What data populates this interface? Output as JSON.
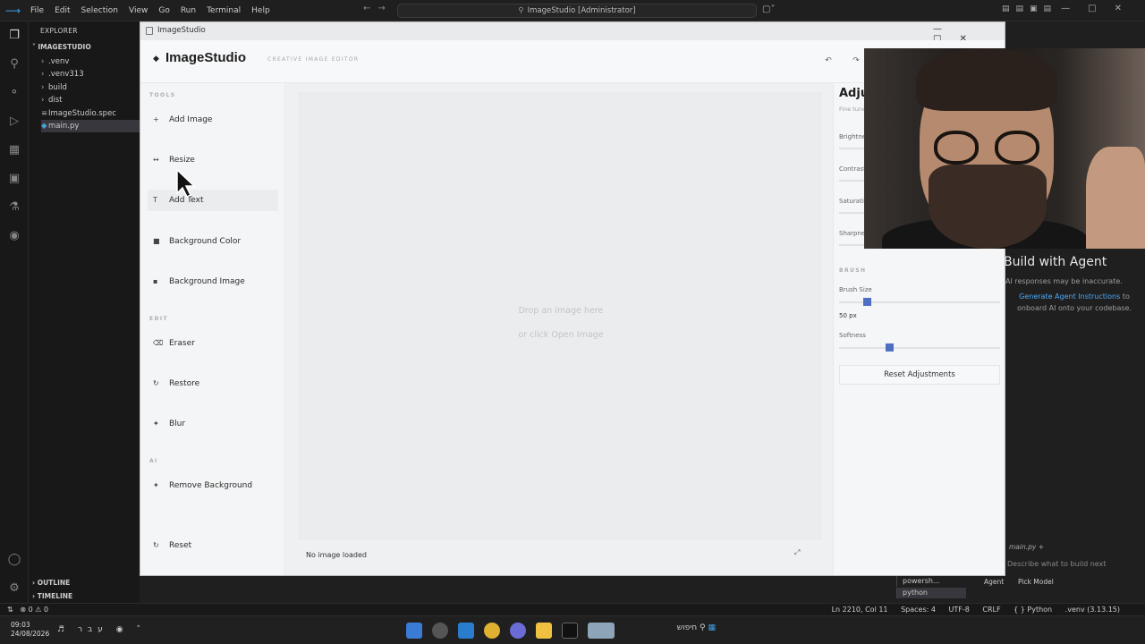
{
  "vscode": {
    "menu": [
      "File",
      "Edit",
      "Selection",
      "View",
      "Go",
      "Run",
      "Terminal",
      "Help"
    ],
    "search_text": "ImageStudio [Administrator]",
    "explorer_title": "EXPLORER",
    "folder": "IMAGESTUDIO",
    "files": [
      ".venv",
      ".venv313",
      "build",
      "dist",
      "ImageStudio.spec",
      "main.py"
    ],
    "outline": "OUTLINE",
    "timeline": "TIMELINE",
    "status_left": "⊗ 0 ⚠ 0",
    "status_right": [
      "Ln 2210, Col 11",
      "Spaces: 4",
      "UTF-8",
      "CRLF",
      "{ } Python",
      ".venv (3.13.15)"
    ],
    "chat": {
      "title": "Build with Agent",
      "subtitle": "AI responses may be inaccurate.",
      "link_prefix": "",
      "link_text": "Generate Agent Instructions",
      "link_suffix": "to onboard AI onto your codebase.",
      "context_file": "main.py",
      "input_placeholder": "Describe what to build next",
      "agent_label": "Agent",
      "model_label": "Pick Model"
    },
    "terminals": [
      "powersh...",
      "python"
    ]
  },
  "taskbar": {
    "time": "09:03",
    "date": "24/08/2026",
    "lang": "עבר",
    "search": "חיפוש"
  },
  "imagestudio": {
    "window_title": "ImageStudio",
    "app_name": "ImageStudio",
    "tagline": "CREATIVE IMAGE EDITOR",
    "sections": {
      "tools": "TOOLS",
      "edit": "EDIT",
      "ai": "AI"
    },
    "tools": [
      {
        "label": "Add Image",
        "icon": "+"
      },
      {
        "label": "Resize",
        "icon": "↔"
      },
      {
        "label": "Add Text",
        "icon": "T"
      },
      {
        "label": "Background Color",
        "icon": "■"
      },
      {
        "label": "Background Image",
        "icon": "▪"
      }
    ],
    "edit_tools": [
      {
        "label": "Eraser",
        "icon": "⌫"
      },
      {
        "label": "Restore",
        "icon": "↻"
      },
      {
        "label": "Blur",
        "icon": "✦"
      }
    ],
    "ai_tools": [
      {
        "label": "Remove Background",
        "icon": "✦"
      }
    ],
    "reset_label": "Reset",
    "canvas": {
      "drop_line1": "Drop an image here",
      "drop_line2": "or click Open Image",
      "status": "No image loaded",
      "fit_icon": "⤢"
    },
    "adjustments": {
      "title": "Adjustments",
      "subtitle": "Fine tune",
      "labels": [
        "Brightness",
        "Contrast",
        "Saturation",
        "Sharpness"
      ],
      "brush_section": "BRUSH",
      "brush_size_label": "Brush Size",
      "brush_size_value": "50 px",
      "brush_size_fraction": 0.17,
      "softness_label": "Softness",
      "softness_fraction": 0.31,
      "reset_label": "Reset Adjustments"
    }
  }
}
